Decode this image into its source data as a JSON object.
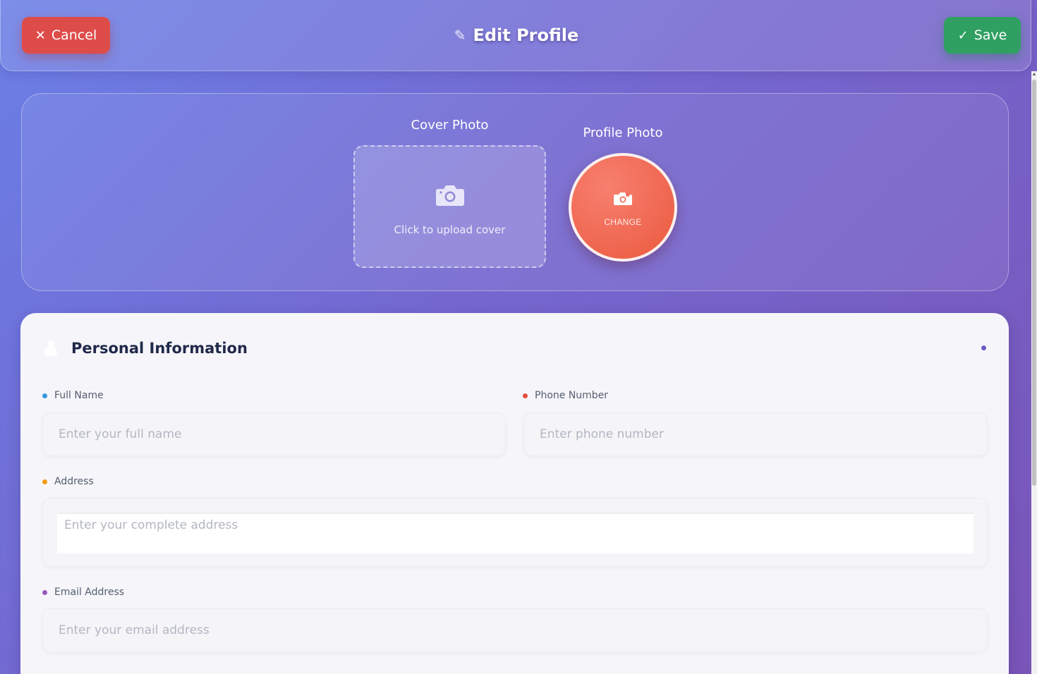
{
  "header": {
    "cancel_icon": "✕",
    "cancel_label": "Cancel",
    "title_icon": "✎",
    "title": "Edit Profile",
    "save_icon": "✓",
    "save_label": "Save"
  },
  "photos": {
    "cover_label": "Cover Photo",
    "cover_hint": "Click to upload cover",
    "profile_label": "Profile Photo",
    "profile_action": "CHANGE"
  },
  "personal": {
    "title": "Personal Information",
    "full_name": {
      "label": "Full Name",
      "placeholder": "Enter your full name",
      "value": "",
      "dot_color": "#3498db"
    },
    "phone": {
      "label": "Phone Number",
      "placeholder": "Enter phone number",
      "value": "",
      "dot_color": "#e74c3c"
    },
    "address": {
      "label": "Address",
      "placeholder": "Enter your complete address",
      "value": "",
      "dot_color": "#f39c12"
    },
    "email": {
      "label": "Email Address",
      "placeholder": "Enter your email address",
      "value": "",
      "dot_color": "#9b59b6"
    }
  },
  "colors": {
    "cancel": "#de4c4a",
    "save": "#2fa062",
    "profile_circle": "#f06a55",
    "accent_dot": "#6a5bc2"
  },
  "icons": {
    "cover": "camera-icon",
    "profile": "camera-flash-icon",
    "section": "person-icon"
  }
}
